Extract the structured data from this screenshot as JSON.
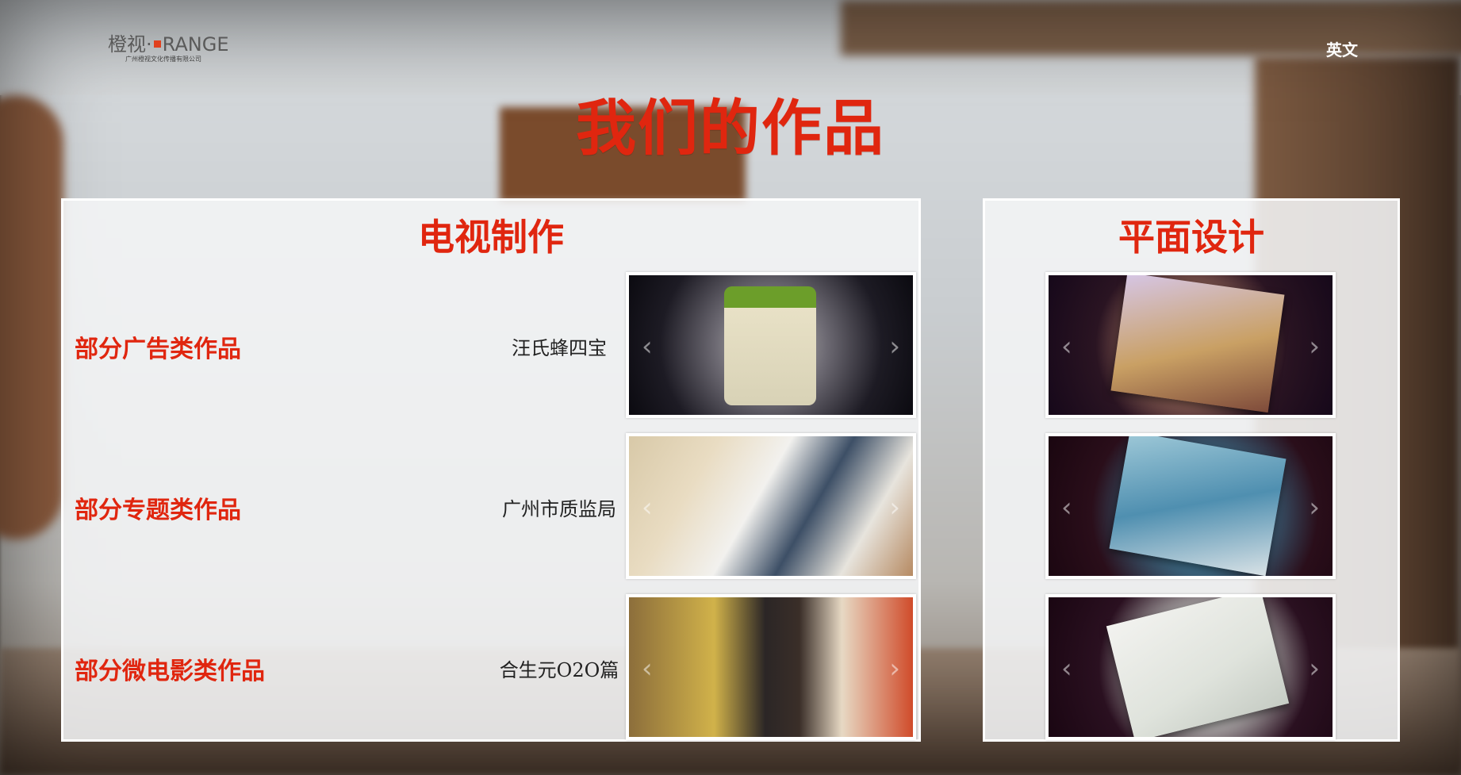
{
  "header": {
    "logo_brand_left": "橙视·",
    "logo_brand_right": "RANGE",
    "logo_subtitle": "广州橙视文化传播有限公司",
    "language_link": "英文"
  },
  "page_title": "我们的作品",
  "tv_panel": {
    "title": "电视制作",
    "rows": [
      {
        "category": "部分广告类作品",
        "item": "汪氏蜂四宝"
      },
      {
        "category": "部分专题类作品",
        "item": "广州市质监局"
      },
      {
        "category": "部分微电影类作品",
        "item": "合生元O2O篇"
      }
    ]
  },
  "print_panel": {
    "title": "平面设计"
  },
  "carousel": {
    "prev": "‹",
    "next": "›"
  },
  "colors": {
    "accent": "#e0260f",
    "panel_bg": "#f4f5f6"
  }
}
